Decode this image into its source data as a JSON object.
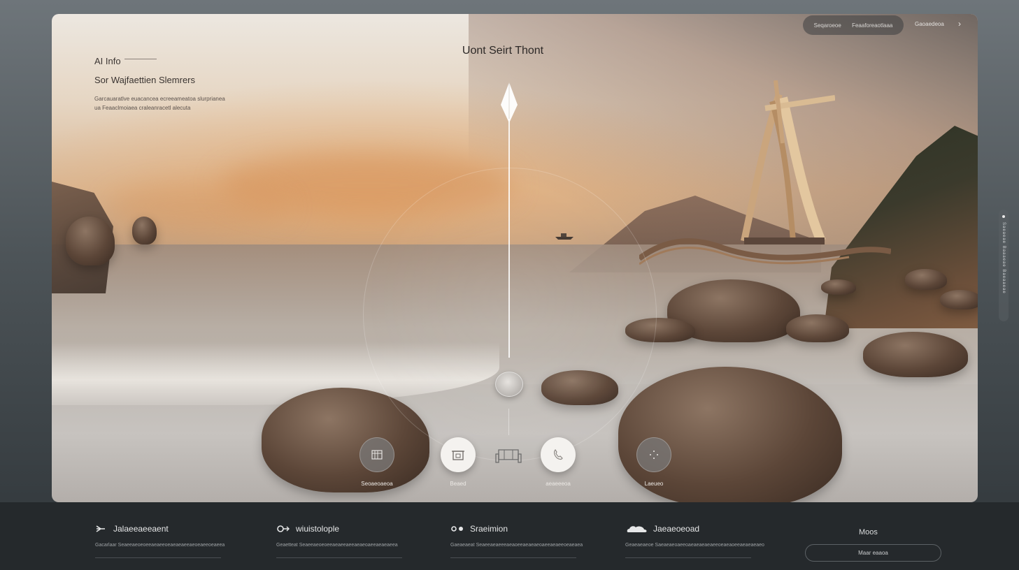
{
  "intro": {
    "eyebrow": "AI Info",
    "title": "Sor Wajfaettien Slemrers",
    "description": "Garcauaratlve euacancea ecreeameatoa slurprianea ua Feaaclmoiaea craleanracetl alecuta"
  },
  "hero": {
    "title": "Uont Seirt Thont"
  },
  "top_nav": {
    "items": [
      "Seqaroeoe",
      "Feaaforeaotlaaa"
    ],
    "right_label": "Gaoaedeoa",
    "chevron": "›"
  },
  "actions": [
    {
      "label": "Seoaeoaeoa",
      "icon": "building-icon",
      "style": "dark"
    },
    {
      "label": "Beaed",
      "icon": "home-icon",
      "style": "light"
    },
    {
      "label": "",
      "icon": "sofa-icon",
      "style": "ghost"
    },
    {
      "label": "aeaeeeoa",
      "icon": "phone-icon",
      "style": "light"
    },
    {
      "label": "Laeueo",
      "icon": "compass-icon",
      "style": "dark"
    }
  ],
  "side_rail": {
    "text": "Saeaeae Baaaeae Baeaaeae"
  },
  "features": [
    {
      "title": "Jalaeeaeeaent",
      "icon": "arrow-icon",
      "description": "Gacarlaar Seaeeaeoeoeeaeaeeoeaeaeaeeaeoeaeeoeaeea"
    },
    {
      "title": "wiuistolople",
      "icon": "link-icon",
      "description": "Geaetteat Seaeeaeoeoeeaeaeeaeeaeaeoaeeaeaeaeea"
    },
    {
      "title": "Sraeimion",
      "icon": "circles-icon",
      "description": "Gaeaeaeat Seaeeaeaeeeaeaoeeaeaeaeoaeeaeaeeoeaeaea"
    },
    {
      "title": "Jaeaeoeoad",
      "icon": "cloud-icon",
      "description": "Geaeaeaeoe Saeaeaeoaeeoaeaeaeaeaeeoeaeaoeeaeaeaeaeo"
    }
  ],
  "more": {
    "title": "Moos",
    "button": "Maar eaaoa"
  },
  "colors": {
    "bottom_bg": "#25292c",
    "accent_light": "#f4f2ef"
  }
}
